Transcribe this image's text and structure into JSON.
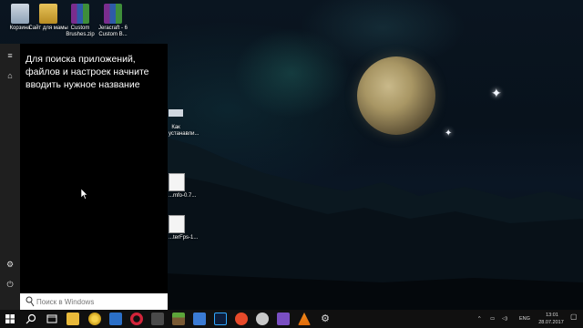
{
  "desktop": {
    "icons": [
      {
        "label": "Корзина"
      },
      {
        "label": "Сайт для мамы"
      },
      {
        "label": "Custom Brushes.zip"
      },
      {
        "label": "Jeracraft - 6 Custom B..."
      }
    ],
    "partial_icons": [
      {
        "label": "Как\nустанавли..."
      },
      {
        "label": "...mfo-0.7..."
      },
      {
        "label": "...terFps-1..."
      }
    ]
  },
  "start_menu": {
    "hint_text": "Для поиска приложений, файлов и настроек начните вводить нужное название",
    "rail_icons": [
      "hamburger-icon",
      "home-icon",
      "gear-icon",
      "power-icon"
    ],
    "search": {
      "value": "",
      "placeholder": "Поиск в Windows"
    }
  },
  "taskbar": {
    "pinned": [
      "search-icon",
      "task-view-icon",
      "file-explorer-icon",
      "chrome-canary-icon",
      "store-icon",
      "opera-icon",
      "calculator-icon",
      "minecraft-icon",
      "photos-icon",
      "photoshop-icon",
      "java-icon",
      "media-icon",
      "visual-studio-icon",
      "vlc-icon",
      "settings-icon"
    ],
    "tray": {
      "language": "ENG",
      "time": "13:01",
      "date": "28.07.2017"
    }
  },
  "colors": {
    "start_panel": "#000000",
    "start_rail": "#1f1f1f",
    "taskbar": "#101010",
    "search_box": "#ffffff"
  }
}
